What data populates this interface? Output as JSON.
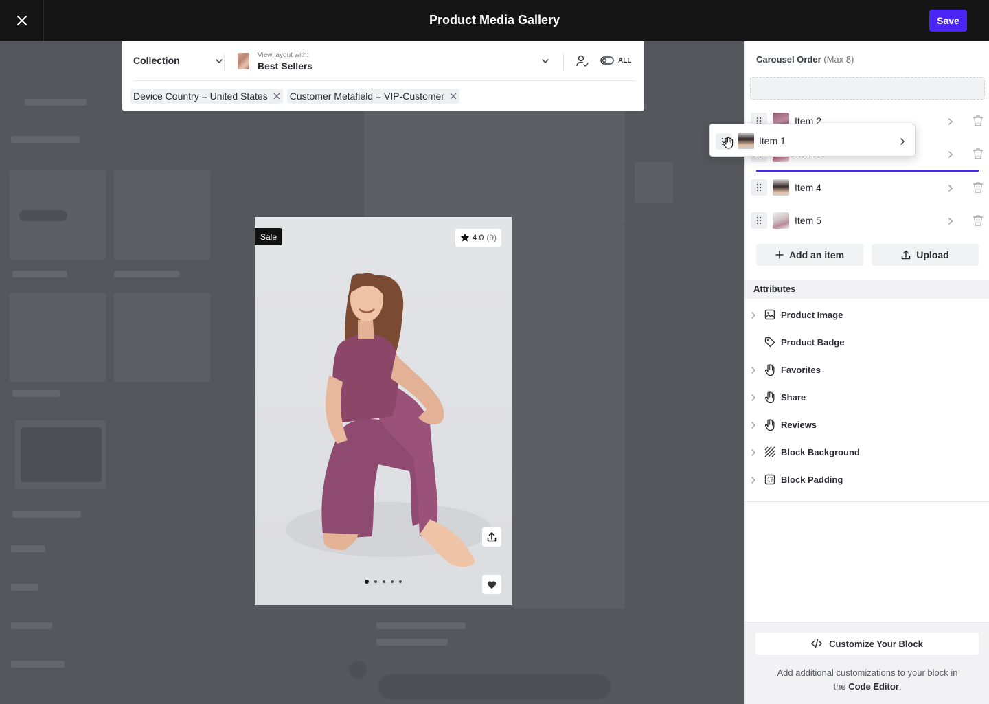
{
  "header": {
    "title": "Product Media Gallery",
    "save_label": "Save"
  },
  "filters": {
    "collection_label": "Collection",
    "view_caption": "View layout with:",
    "view_value": "Best Sellers",
    "all_toggle": "ALL",
    "chips": [
      "Device Country = United States",
      "Customer Metafield = VIP-Customer"
    ]
  },
  "preview": {
    "badge": "Sale",
    "rating": "4.0",
    "rating_count": "(9)",
    "image_count": 5,
    "active_image": 1
  },
  "sidebar": {
    "carousel_title": "Carousel Order",
    "carousel_max": "(Max 8)",
    "dragging_item": "Item 1",
    "items": [
      "Item 2",
      "Item 3",
      "Item 4",
      "Item 5"
    ],
    "add_item": "Add an item",
    "upload": "Upload",
    "attributes_title": "Attributes",
    "attributes": [
      {
        "label": "Product Image",
        "icon": "image-icon",
        "expandable": true
      },
      {
        "label": "Product Badge",
        "icon": "tag-icon",
        "expandable": false
      },
      {
        "label": "Favorites",
        "icon": "hand-pointer-icon",
        "expandable": true
      },
      {
        "label": "Share",
        "icon": "hand-pointer-icon",
        "expandable": true
      },
      {
        "label": "Reviews",
        "icon": "hand-pointer-icon",
        "expandable": true
      },
      {
        "label": "Block Background",
        "icon": "hatch-pattern-icon",
        "expandable": true
      },
      {
        "label": "Block Padding",
        "icon": "padding-box-icon",
        "expandable": true
      }
    ],
    "customize_label": "Customize Your Block",
    "customize_note_pre": "Add additional customizations to your block in the",
    "customize_note_link": "Code Editor",
    "customize_note_post": "."
  },
  "colors": {
    "accent": "#4a25f5",
    "topbar": "#151515"
  }
}
